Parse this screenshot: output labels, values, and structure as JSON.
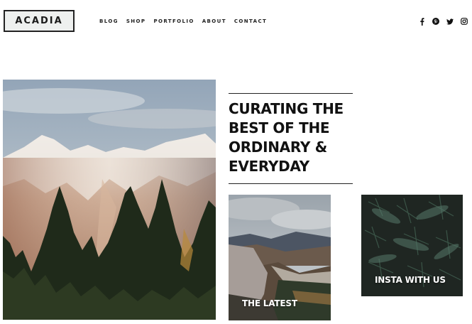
{
  "brand": {
    "logo_text": "ACADIA"
  },
  "nav": {
    "items": [
      "BLOG",
      "SHOP",
      "PORTFOLIO",
      "ABOUT",
      "CONTACT"
    ]
  },
  "social": {
    "icons": [
      "facebook-icon",
      "pinterest-icon",
      "twitter-icon",
      "instagram-icon"
    ]
  },
  "hero": {
    "headline": "CURATING THE BEST OF THE ORDINARY & EVERYDAY"
  },
  "cards": {
    "latest_label": "THE LATEST",
    "insta_label": "INSTA WITH US"
  },
  "colors": {
    "text": "#111111",
    "background": "#ffffff",
    "logo_bg": "#eef0ef"
  }
}
